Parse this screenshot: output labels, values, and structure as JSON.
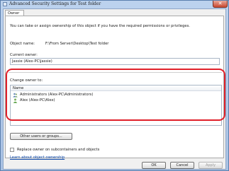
{
  "window": {
    "title": "Advanced Security Settings for Test folder",
    "close_label": "✕"
  },
  "tab": {
    "label": "Owner"
  },
  "panel": {
    "intro": "You can take or assign ownership of this object if you have the required permissions or privileges.",
    "object_name_label": "Object name:",
    "object_name_value": "F:\\From Server\\Desktop\\Test folder",
    "current_owner_label": "Current owner:",
    "current_owner_value": "Jassie (Alex-PC\\Jassie)",
    "change_owner_label": "Change owner to:",
    "list_header_name": "Name",
    "owners": [
      {
        "name": "Administrators (Alex-PC\\Administrators)",
        "icon": "group-icon"
      },
      {
        "name": "Alex (Alex-PC\\Alex)",
        "icon": "user-icon"
      }
    ],
    "other_users_button": "Other users or groups...",
    "replace_checkbox_label": "Replace owner on subcontainers and objects",
    "replace_checked": false,
    "learn_link": "Learn about object ownership"
  },
  "footer": {
    "ok": "OK",
    "cancel": "Cancel",
    "apply": "Apply"
  },
  "colors": {
    "highlight": "#e0202a",
    "link": "#0a46a8"
  }
}
